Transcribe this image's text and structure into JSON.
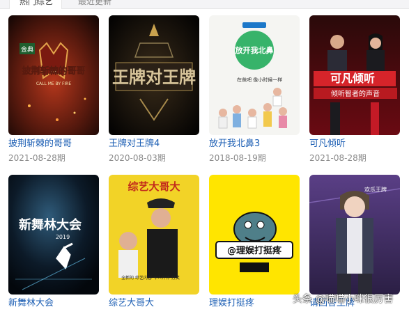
{
  "tabs": [
    {
      "label": "热门综艺",
      "active": true
    },
    {
      "label": "最近更新",
      "active": false
    }
  ],
  "shows": [
    {
      "title": "披荆斩棘的哥哥",
      "date": "2021-08-28期",
      "poster_text": "披荆斩棘的哥哥",
      "poster_sub": "CALL ME BY FIRE",
      "logo": "金典"
    },
    {
      "title": "王牌对王牌4",
      "date": "2020-08-03期",
      "poster_text": "王牌对王牌"
    },
    {
      "title": "放开我北鼻3",
      "date": "2018-08-19期",
      "poster_text": "放开我北鼻",
      "poster_sub": "在爸吧 像小时候一样"
    },
    {
      "title": "可凡倾听",
      "date": "2021-08-28期",
      "poster_text": "可凡倾听",
      "poster_sub": "倾听智者的声音"
    },
    {
      "title": "新舞林大会",
      "date": "",
      "poster_text": "新舞林大会",
      "poster_sub": "2019"
    },
    {
      "title": "综艺大哥大",
      "date": "",
      "poster_text": "综艺大哥大",
      "poster_sub": "全新的 综艺内容 令人开怀 打笑"
    },
    {
      "title": "理娱打挺疼",
      "date": "",
      "poster_text": "@理娱打挺疼"
    },
    {
      "title": "请回答王牌",
      "date": "",
      "poster_text": "欢乐王牌"
    }
  ],
  "watermark": "头条 @喵喵小咪很厉害",
  "colors": {
    "title_link": "#1d5fb4",
    "date": "#8a8a8a"
  }
}
